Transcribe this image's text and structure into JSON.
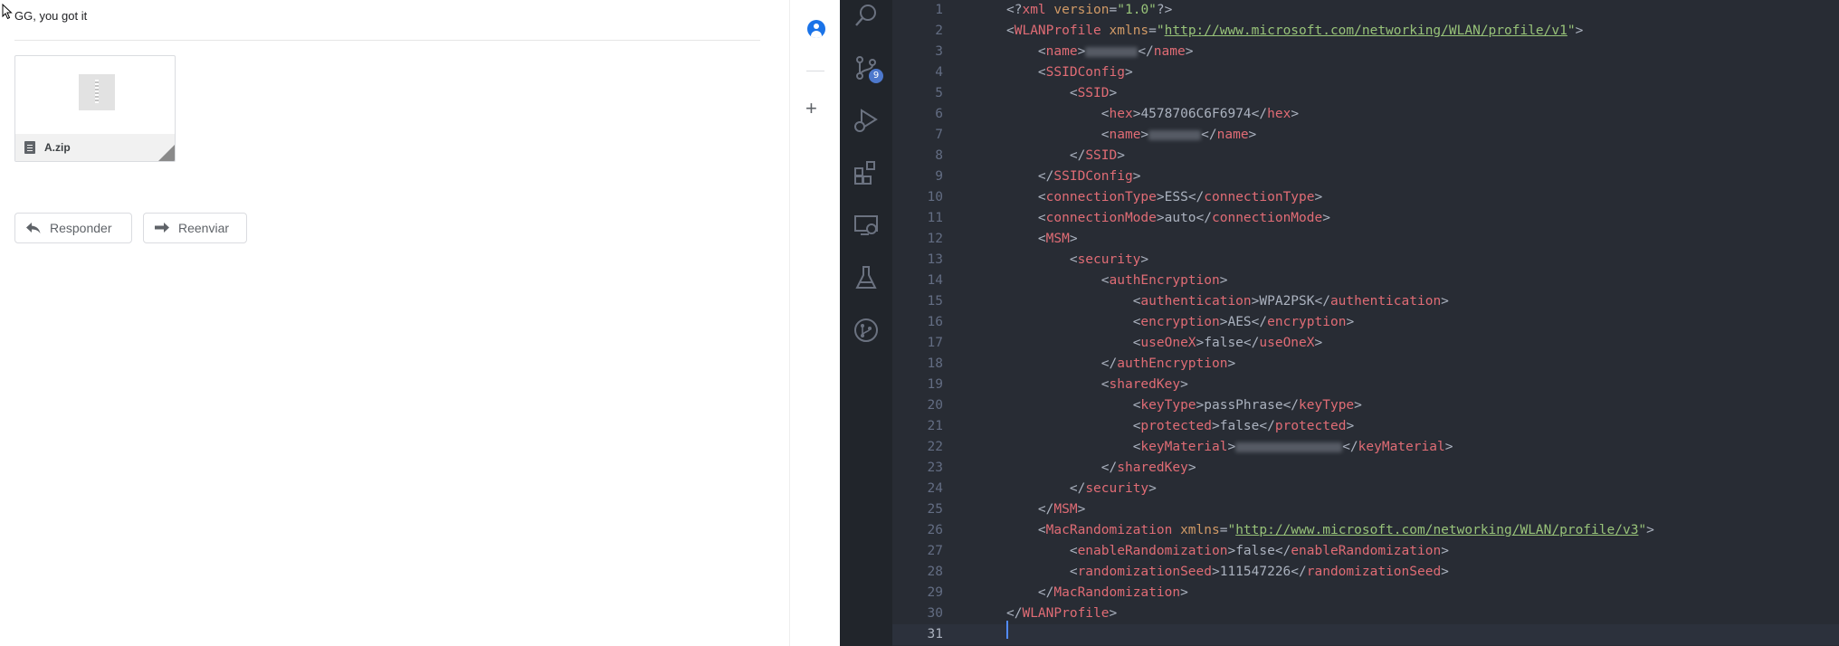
{
  "email": {
    "message_text": "GG, you got it",
    "attachment": {
      "file_name": "A.zip"
    },
    "buttons": {
      "reply_label": "Responder",
      "forward_label": "Reenviar"
    }
  },
  "gmail_side": {
    "icons": [
      "contacts-icon",
      "add-icon"
    ]
  },
  "vscode": {
    "activity_bar": {
      "items": [
        "search-icon",
        "source-control-icon",
        "run-debug-icon",
        "extensions-icon",
        "remote-explorer-icon",
        "testing-icon",
        "git-graph-icon"
      ],
      "source_control_badge": "9"
    },
    "editor": {
      "lines": [
        {
          "num": "1",
          "pre": "",
          "parts": [
            {
              "c": "gp",
              "t": "<?"
            },
            {
              "c": "gt",
              "t": "xml"
            },
            {
              "c": "gx",
              "t": " "
            },
            {
              "c": "ga",
              "t": "version"
            },
            {
              "c": "gx",
              "t": "="
            },
            {
              "c": "gs",
              "t": "\"1.0\""
            },
            {
              "c": "gp",
              "t": "?>"
            }
          ]
        },
        {
          "num": "2",
          "pre": "",
          "parts": [
            {
              "c": "gp",
              "t": "<"
            },
            {
              "c": "gt",
              "t": "WLANProfile"
            },
            {
              "c": "gx",
              "t": " "
            },
            {
              "c": "ga",
              "t": "xmlns"
            },
            {
              "c": "gx",
              "t": "="
            },
            {
              "c": "gs",
              "t": "\""
            },
            {
              "c": "gu",
              "t": "http://www.microsoft.com/networking/WLAN/profile/v1"
            },
            {
              "c": "gs",
              "t": "\""
            },
            {
              "c": "gp",
              "t": ">"
            }
          ]
        },
        {
          "num": "3",
          "pre": "    ",
          "parts": [
            {
              "c": "gp",
              "t": "<"
            },
            {
              "c": "gt",
              "t": "name"
            },
            {
              "c": "gp",
              "t": ">"
            },
            {
              "c": "blur",
              "w": 58
            },
            {
              "c": "gp",
              "t": "</"
            },
            {
              "c": "gt",
              "t": "name"
            },
            {
              "c": "gp",
              "t": ">"
            }
          ]
        },
        {
          "num": "4",
          "pre": "    ",
          "parts": [
            {
              "c": "gp",
              "t": "<"
            },
            {
              "c": "gt",
              "t": "SSIDConfig"
            },
            {
              "c": "gp",
              "t": ">"
            }
          ]
        },
        {
          "num": "5",
          "pre": "        ",
          "parts": [
            {
              "c": "gp",
              "t": "<"
            },
            {
              "c": "gt",
              "t": "SSID"
            },
            {
              "c": "gp",
              "t": ">"
            }
          ]
        },
        {
          "num": "6",
          "pre": "            ",
          "parts": [
            {
              "c": "gp",
              "t": "<"
            },
            {
              "c": "gt",
              "t": "hex"
            },
            {
              "c": "gp",
              "t": ">"
            },
            {
              "c": "gx",
              "t": "4578706C6F6974"
            },
            {
              "c": "gp",
              "t": "</"
            },
            {
              "c": "gt",
              "t": "hex"
            },
            {
              "c": "gp",
              "t": ">"
            }
          ]
        },
        {
          "num": "7",
          "pre": "            ",
          "parts": [
            {
              "c": "gp",
              "t": "<"
            },
            {
              "c": "gt",
              "t": "name"
            },
            {
              "c": "gp",
              "t": ">"
            },
            {
              "c": "blur",
              "w": 58
            },
            {
              "c": "gp",
              "t": "</"
            },
            {
              "c": "gt",
              "t": "name"
            },
            {
              "c": "gp",
              "t": ">"
            }
          ]
        },
        {
          "num": "8",
          "pre": "        ",
          "parts": [
            {
              "c": "gp",
              "t": "</"
            },
            {
              "c": "gt",
              "t": "SSID"
            },
            {
              "c": "gp",
              "t": ">"
            }
          ]
        },
        {
          "num": "9",
          "pre": "    ",
          "parts": [
            {
              "c": "gp",
              "t": "</"
            },
            {
              "c": "gt",
              "t": "SSIDConfig"
            },
            {
              "c": "gp",
              "t": ">"
            }
          ]
        },
        {
          "num": "10",
          "pre": "    ",
          "parts": [
            {
              "c": "gp",
              "t": "<"
            },
            {
              "c": "gt",
              "t": "connectionType"
            },
            {
              "c": "gp",
              "t": ">"
            },
            {
              "c": "gx",
              "t": "ESS"
            },
            {
              "c": "gp",
              "t": "</"
            },
            {
              "c": "gt",
              "t": "connectionType"
            },
            {
              "c": "gp",
              "t": ">"
            }
          ]
        },
        {
          "num": "11",
          "pre": "    ",
          "parts": [
            {
              "c": "gp",
              "t": "<"
            },
            {
              "c": "gt",
              "t": "connectionMode"
            },
            {
              "c": "gp",
              "t": ">"
            },
            {
              "c": "gx",
              "t": "auto"
            },
            {
              "c": "gp",
              "t": "</"
            },
            {
              "c": "gt",
              "t": "connectionMode"
            },
            {
              "c": "gp",
              "t": ">"
            }
          ]
        },
        {
          "num": "12",
          "pre": "    ",
          "parts": [
            {
              "c": "gp",
              "t": "<"
            },
            {
              "c": "gt",
              "t": "MSM"
            },
            {
              "c": "gp",
              "t": ">"
            }
          ]
        },
        {
          "num": "13",
          "pre": "        ",
          "parts": [
            {
              "c": "gp",
              "t": "<"
            },
            {
              "c": "gt",
              "t": "security"
            },
            {
              "c": "gp",
              "t": ">"
            }
          ]
        },
        {
          "num": "14",
          "pre": "            ",
          "parts": [
            {
              "c": "gp",
              "t": "<"
            },
            {
              "c": "gt",
              "t": "authEncryption"
            },
            {
              "c": "gp",
              "t": ">"
            }
          ]
        },
        {
          "num": "15",
          "pre": "                ",
          "parts": [
            {
              "c": "gp",
              "t": "<"
            },
            {
              "c": "gt",
              "t": "authentication"
            },
            {
              "c": "gp",
              "t": ">"
            },
            {
              "c": "gx",
              "t": "WPA2PSK"
            },
            {
              "c": "gp",
              "t": "</"
            },
            {
              "c": "gt",
              "t": "authentication"
            },
            {
              "c": "gp",
              "t": ">"
            }
          ]
        },
        {
          "num": "16",
          "pre": "                ",
          "parts": [
            {
              "c": "gp",
              "t": "<"
            },
            {
              "c": "gt",
              "t": "encryption"
            },
            {
              "c": "gp",
              "t": ">"
            },
            {
              "c": "gx",
              "t": "AES"
            },
            {
              "c": "gp",
              "t": "</"
            },
            {
              "c": "gt",
              "t": "encryption"
            },
            {
              "c": "gp",
              "t": ">"
            }
          ]
        },
        {
          "num": "17",
          "pre": "                ",
          "parts": [
            {
              "c": "gp",
              "t": "<"
            },
            {
              "c": "gt",
              "t": "useOneX"
            },
            {
              "c": "gp",
              "t": ">"
            },
            {
              "c": "gx",
              "t": "false"
            },
            {
              "c": "gp",
              "t": "</"
            },
            {
              "c": "gt",
              "t": "useOneX"
            },
            {
              "c": "gp",
              "t": ">"
            }
          ]
        },
        {
          "num": "18",
          "pre": "            ",
          "parts": [
            {
              "c": "gp",
              "t": "</"
            },
            {
              "c": "gt",
              "t": "authEncryption"
            },
            {
              "c": "gp",
              "t": ">"
            }
          ]
        },
        {
          "num": "19",
          "pre": "            ",
          "parts": [
            {
              "c": "gp",
              "t": "<"
            },
            {
              "c": "gt",
              "t": "sharedKey"
            },
            {
              "c": "gp",
              "t": ">"
            }
          ]
        },
        {
          "num": "20",
          "pre": "                ",
          "parts": [
            {
              "c": "gp",
              "t": "<"
            },
            {
              "c": "gt",
              "t": "keyType"
            },
            {
              "c": "gp",
              "t": ">"
            },
            {
              "c": "gx",
              "t": "passPhrase"
            },
            {
              "c": "gp",
              "t": "</"
            },
            {
              "c": "gt",
              "t": "keyType"
            },
            {
              "c": "gp",
              "t": ">"
            }
          ]
        },
        {
          "num": "21",
          "pre": "                ",
          "parts": [
            {
              "c": "gp",
              "t": "<"
            },
            {
              "c": "gt",
              "t": "protected"
            },
            {
              "c": "gp",
              "t": ">"
            },
            {
              "c": "gx",
              "t": "false"
            },
            {
              "c": "gp",
              "t": "</"
            },
            {
              "c": "gt",
              "t": "protected"
            },
            {
              "c": "gp",
              "t": ">"
            }
          ]
        },
        {
          "num": "22",
          "pre": "                ",
          "parts": [
            {
              "c": "gp",
              "t": "<"
            },
            {
              "c": "gt",
              "t": "keyMaterial"
            },
            {
              "c": "gp",
              "t": ">"
            },
            {
              "c": "blur",
              "w": 118
            },
            {
              "c": "gp",
              "t": "</"
            },
            {
              "c": "gt",
              "t": "keyMaterial"
            },
            {
              "c": "gp",
              "t": ">"
            }
          ]
        },
        {
          "num": "23",
          "pre": "            ",
          "parts": [
            {
              "c": "gp",
              "t": "</"
            },
            {
              "c": "gt",
              "t": "sharedKey"
            },
            {
              "c": "gp",
              "t": ">"
            }
          ]
        },
        {
          "num": "24",
          "pre": "        ",
          "parts": [
            {
              "c": "gp",
              "t": "</"
            },
            {
              "c": "gt",
              "t": "security"
            },
            {
              "c": "gp",
              "t": ">"
            }
          ]
        },
        {
          "num": "25",
          "pre": "    ",
          "parts": [
            {
              "c": "gp",
              "t": "</"
            },
            {
              "c": "gt",
              "t": "MSM"
            },
            {
              "c": "gp",
              "t": ">"
            }
          ]
        },
        {
          "num": "26",
          "pre": "    ",
          "parts": [
            {
              "c": "gp",
              "t": "<"
            },
            {
              "c": "gt",
              "t": "MacRandomization"
            },
            {
              "c": "gx",
              "t": " "
            },
            {
              "c": "ga",
              "t": "xmlns"
            },
            {
              "c": "gx",
              "t": "="
            },
            {
              "c": "gs",
              "t": "\""
            },
            {
              "c": "gu",
              "t": "http://www.microsoft.com/networking/WLAN/profile/v3"
            },
            {
              "c": "gs",
              "t": "\""
            },
            {
              "c": "gp",
              "t": ">"
            }
          ]
        },
        {
          "num": "27",
          "pre": "        ",
          "parts": [
            {
              "c": "gp",
              "t": "<"
            },
            {
              "c": "gt",
              "t": "enableRandomization"
            },
            {
              "c": "gp",
              "t": ">"
            },
            {
              "c": "gx",
              "t": "false"
            },
            {
              "c": "gp",
              "t": "</"
            },
            {
              "c": "gt",
              "t": "enableRandomization"
            },
            {
              "c": "gp",
              "t": ">"
            }
          ]
        },
        {
          "num": "28",
          "pre": "        ",
          "parts": [
            {
              "c": "gp",
              "t": "<"
            },
            {
              "c": "gt",
              "t": "randomizationSeed"
            },
            {
              "c": "gp",
              "t": ">"
            },
            {
              "c": "gx",
              "t": "111547226"
            },
            {
              "c": "gp",
              "t": "</"
            },
            {
              "c": "gt",
              "t": "randomizationSeed"
            },
            {
              "c": "gp",
              "t": ">"
            }
          ]
        },
        {
          "num": "29",
          "pre": "    ",
          "parts": [
            {
              "c": "gp",
              "t": "</"
            },
            {
              "c": "gt",
              "t": "MacRandomization"
            },
            {
              "c": "gp",
              "t": ">"
            }
          ]
        },
        {
          "num": "30",
          "pre": "",
          "parts": [
            {
              "c": "gp",
              "t": "</"
            },
            {
              "c": "gt",
              "t": "WLANProfile"
            },
            {
              "c": "gp",
              "t": ">"
            }
          ]
        },
        {
          "num": "31",
          "pre": "",
          "parts": []
        }
      ]
    },
    "colors": {
      "editor_bg": "#282c34",
      "activity_bg": "#21252b",
      "tag": "#e06c75",
      "attribute": "#d19a66",
      "string": "#98c379",
      "text": "#abb2bf",
      "badge": "#4d78cc"
    }
  }
}
